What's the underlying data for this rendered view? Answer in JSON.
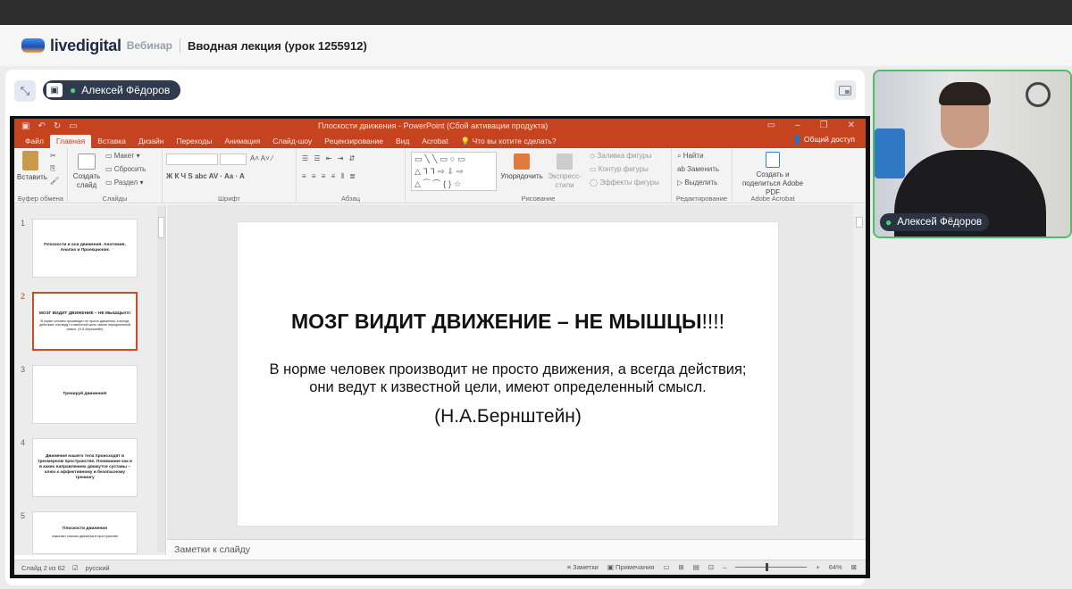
{
  "header": {
    "brand": "livedigital",
    "product": "Вебинар",
    "title": "Вводная лекция (урок 1255912)"
  },
  "stage": {
    "speaker_name": "Алексей Фёдоров"
  },
  "ppt": {
    "window_title": "Плоскости движения - PowerPoint (Сбой активации продукта)",
    "tabs": [
      "Файл",
      "Главная",
      "Вставка",
      "Дизайн",
      "Переходы",
      "Анимация",
      "Слайд-шоу",
      "Рецензирование",
      "Вид",
      "Acrobat"
    ],
    "tell_me": "Что вы хотите сделать?",
    "share": "Общий доступ",
    "ribbon": {
      "paste": "Вставить",
      "clipboard_group": "Буфер обмена",
      "new_slide": "Создать слайд",
      "layout": "Макет",
      "reset": "Сбросить",
      "section": "Раздел",
      "slides_group": "Слайды",
      "font_group": "Шрифт",
      "paragraph_group": "Абзац",
      "arrange": "Упорядочить",
      "quick_styles": "Экспресс-стили",
      "shape_fill": "Заливка фигуры",
      "shape_outline": "Контур фигуры",
      "shape_effects": "Эффекты фигуры",
      "drawing_group": "Рисование",
      "find": "Найти",
      "replace": "Заменить",
      "select": "Выделить",
      "editing_group": "Редактирование",
      "acrobat_btn": "Создать и поделиться Adobe PDF",
      "acrobat_group": "Adobe Acrobat"
    },
    "thumbnails": [
      {
        "num": "1",
        "title": "Плоскости и оси движения. Анатомия, Анализ и Проекционис",
        "sub": ""
      },
      {
        "num": "2",
        "title": "МОЗГ ВИДИТ ДВИЖЕНИЕ – НЕ МЫШЦЫ!!!!",
        "sub": "В норме человек производит не просто движения, а всегда действия; они ведут к известной цели, имеют определенный смысл. (Н.А.Бернштейн)"
      },
      {
        "num": "3",
        "title": "Тренируй движения!",
        "sub": ""
      },
      {
        "num": "4",
        "title": "Движения нашего тела происходят в трехмерном пространстве. Понимание как и в каких направлениях движутся суставы – ключ к эффективному и безопасному тренингу",
        "sub": ""
      },
      {
        "num": "5",
        "title": "Плоскости движения",
        "sub": "помогают описать движения в пространстве"
      }
    ],
    "slide": {
      "title_main": "МОЗГ ВИДИТ ДВИЖЕНИЕ – НЕ МЫШЦЫ",
      "title_excl": "!!!!",
      "body_line1": "В норме человек производит не просто движения, а всегда действия;",
      "body_line2": "они ведут к известной цели, имеют определенный смысл.",
      "author": "(Н.А.Бернштейн)"
    },
    "notes_placeholder": "Заметки к слайду",
    "status": {
      "slide_counter": "Слайд 2 из 62",
      "language": "русский",
      "notes": "Заметки",
      "comments": "Примечания",
      "zoom": "64%"
    }
  },
  "camera": {
    "name": "Алексей Фёдоров"
  },
  "colors": {
    "ppt_accent": "#c5441f",
    "camera_border": "#4cbf64",
    "pill_bg": "#2f3a4f"
  }
}
